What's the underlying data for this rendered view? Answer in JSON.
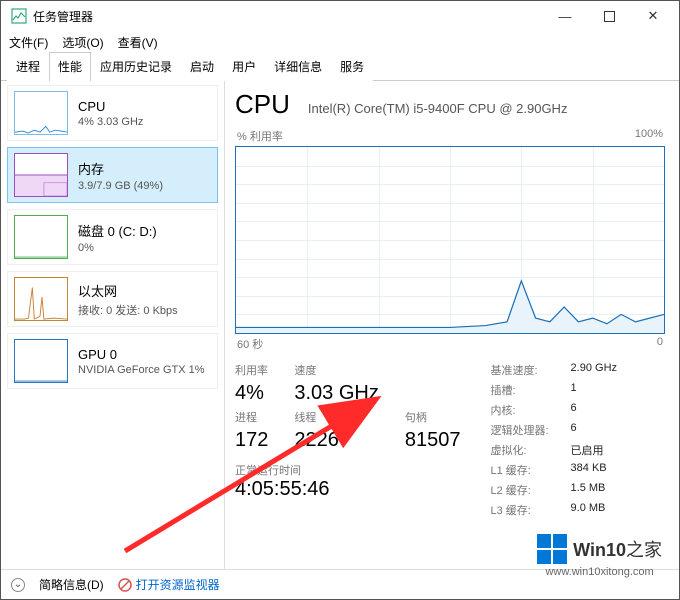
{
  "window": {
    "title": "任务管理器"
  },
  "menu": {
    "file": "文件(F)",
    "options": "选项(O)",
    "view": "查看(V)"
  },
  "tabs": [
    "进程",
    "性能",
    "应用历史记录",
    "启动",
    "用户",
    "详细信息",
    "服务"
  ],
  "sidebar": {
    "cpu": {
      "title": "CPU",
      "sub": "4% 3.03 GHz"
    },
    "mem": {
      "title": "内存",
      "sub": "3.9/7.9 GB (49%)"
    },
    "disk": {
      "title": "磁盘 0 (C: D:)",
      "sub": "0%"
    },
    "eth": {
      "title": "以太网",
      "sub": "接收: 0 发送: 0 Kbps"
    },
    "gpu": {
      "title": "GPU 0",
      "sub": "NVIDIA GeForce GTX 1%"
    }
  },
  "main": {
    "title": "CPU",
    "subtitle": "Intel(R) Core(TM) i5-9400F CPU @ 2.90GHz",
    "graph_label_left": "% 利用率",
    "graph_label_right": "100%",
    "graph_x_left": "60 秒",
    "graph_x_right": "0",
    "stats": {
      "util_lbl": "利用率",
      "util_val": "4%",
      "speed_lbl": "速度",
      "speed_val": "3.03 GHz",
      "proc_lbl": "进程",
      "proc_val": "172",
      "thr_lbl": "线程",
      "thr_val": "2226",
      "hnd_lbl": "句柄",
      "hnd_val": "81507",
      "uptime_lbl": "正常运行时间",
      "uptime_val": "4:05:55:46"
    },
    "right": {
      "base_k": "基准速度:",
      "base_v": "2.90 GHz",
      "sock_k": "插槽:",
      "sock_v": "1",
      "core_k": "内核:",
      "core_v": "6",
      "lp_k": "逻辑处理器:",
      "lp_v": "6",
      "virt_k": "虚拟化:",
      "virt_v": "已启用",
      "l1_k": "L1 缓存:",
      "l1_v": "384 KB",
      "l2_k": "L2 缓存:",
      "l2_v": "1.5 MB",
      "l3_k": "L3 缓存:",
      "l3_v": "9.0 MB"
    }
  },
  "footer": {
    "simple": "简略信息(D)",
    "resmon": "打开资源监视器"
  },
  "watermark": {
    "text1": "Win10",
    "text2": "之家",
    "url": "www.win10xitong.com"
  },
  "chart_data": {
    "type": "line",
    "title": "% 利用率",
    "xlabel": "秒",
    "ylabel": "%",
    "xlim": [
      60,
      0
    ],
    "ylim": [
      0,
      100
    ],
    "x": [
      60,
      55,
      50,
      45,
      40,
      35,
      30,
      25,
      22,
      20,
      18,
      16,
      14,
      12,
      10,
      8,
      6,
      4,
      2,
      0
    ],
    "values": [
      3,
      3,
      3,
      3,
      3,
      3,
      3,
      4,
      6,
      28,
      8,
      6,
      14,
      6,
      8,
      5,
      10,
      6,
      8,
      10
    ]
  }
}
